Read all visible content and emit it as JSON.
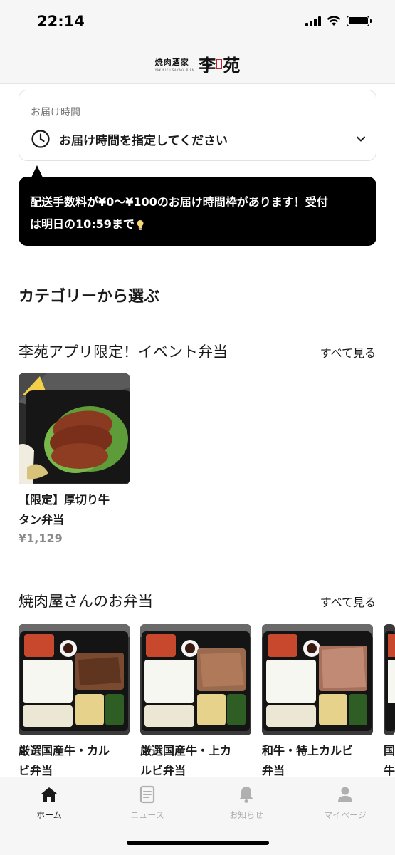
{
  "status_bar": {
    "time": "22:14"
  },
  "header": {
    "logo_sub": "焼肉酒家",
    "logo_tiny": "YAKINIKU SAKAYA RIEN",
    "logo_main_1": "李",
    "logo_main_2": "苑",
    "icon": "brand-logo"
  },
  "delivery": {
    "label": "お届け時間",
    "value": "お届け時間を指定してください",
    "icon": "clock-icon"
  },
  "tooltip": {
    "line1": "配送手数料が¥0〜¥100のお届け時間枠があります！受付",
    "line2": "は明日の10:59まで",
    "icon": "light-bulb-icon"
  },
  "category_title": "カテゴリーから選ぶ",
  "sections": [
    {
      "title": "李苑アプリ限定！イベント弁当",
      "see_all": "すべて見る",
      "products": [
        {
          "name_line1": "【限定】厚切り牛",
          "name_line2": "タン弁当",
          "price": "¥1,129"
        }
      ]
    },
    {
      "title": "焼肉屋さんのお弁当",
      "see_all": "すべて見る",
      "products": [
        {
          "name_line1": "厳選国産牛・カル",
          "name_line2": "ビ弁当"
        },
        {
          "name_line1": "厳選国産牛・上カ",
          "name_line2": "ルビ弁当"
        },
        {
          "name_line1": "和牛・特上カルビ",
          "name_line2": "弁当"
        },
        {
          "name_line1": "国",
          "name_line2": "牛"
        }
      ]
    }
  ],
  "tabs": [
    {
      "label": "ホーム",
      "icon": "home-icon",
      "active": true
    },
    {
      "label": "ニュース",
      "icon": "news-icon",
      "active": false
    },
    {
      "label": "お知らせ",
      "icon": "bell-icon",
      "active": false
    },
    {
      "label": "マイページ",
      "icon": "person-icon",
      "active": false
    }
  ],
  "colors": {
    "accent": "#000000",
    "text": "#1a1a1a",
    "muted": "#8a8a8a",
    "tab_inactive": "#b0b0b0"
  }
}
